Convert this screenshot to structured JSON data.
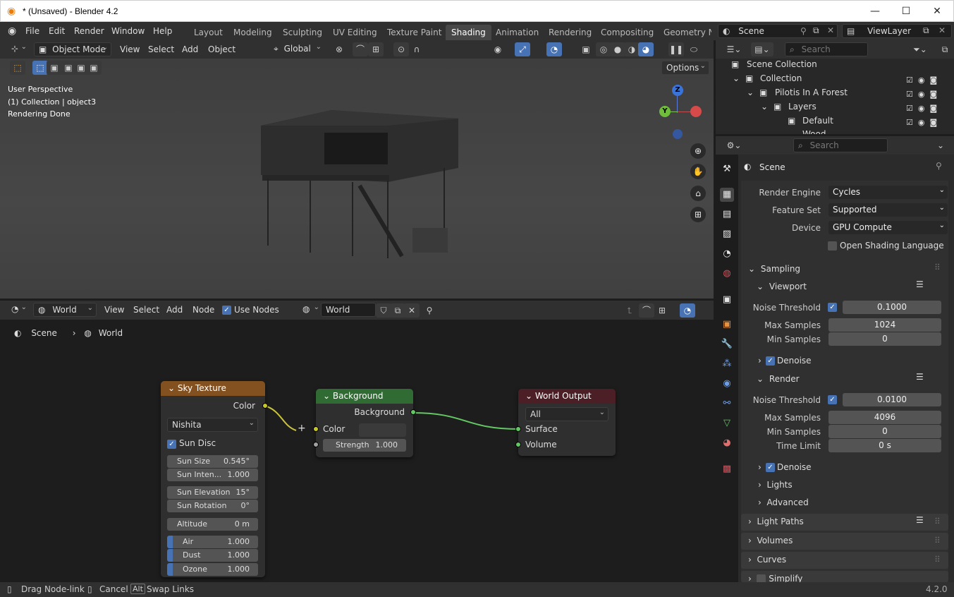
{
  "window": {
    "title": "* (Unsaved) - Blender 4.2"
  },
  "menu": [
    "File",
    "Edit",
    "Render",
    "Window",
    "Help"
  ],
  "workspaces": [
    "Layout",
    "Modeling",
    "Sculpting",
    "UV Editing",
    "Texture Paint",
    "Shading",
    "Animation",
    "Rendering",
    "Compositing",
    "Geometry Nc"
  ],
  "active_workspace": "Shading",
  "scene_name": "Scene",
  "view_layer": "ViewLayer",
  "viewport": {
    "mode": "Object Mode",
    "view": "View",
    "select": "Select",
    "add": "Add",
    "object": "Object",
    "transform": "Global",
    "options": "Options",
    "overlay_lines": [
      "User Perspective",
      "(1) Collection | object3",
      "Rendering Done"
    ],
    "gizmo": {
      "z": "Z",
      "y": "Y"
    }
  },
  "node_editor": {
    "type": "World",
    "view": "View",
    "select": "Select",
    "add": "Add",
    "node": "Node",
    "use_nodes": "Use Nodes",
    "world_name": "World",
    "breadcrumb": [
      "Scene",
      "World"
    ],
    "sky": {
      "title": "Sky Texture",
      "out": "Color",
      "sky_type": "Nishita",
      "sun_disc": "Sun Disc",
      "fields": [
        [
          "Sun Size",
          "0.545°"
        ],
        [
          "Sun Inten...",
          "1.000"
        ],
        [
          "Sun Elevation",
          "15°"
        ],
        [
          "Sun Rotation",
          "0°"
        ],
        [
          "Altitude",
          "0 m"
        ],
        [
          "Air",
          "1.000"
        ],
        [
          "Dust",
          "1.000"
        ],
        [
          "Ozone",
          "1.000"
        ]
      ]
    },
    "background": {
      "title": "Background",
      "out": "Background",
      "color": "Color",
      "strength_label": "Strength",
      "strength": "1.000"
    },
    "output": {
      "title": "World Output",
      "target": "All",
      "surface": "Surface",
      "volume": "Volume"
    }
  },
  "outliner": {
    "search": "Search",
    "items": [
      "Scene Collection",
      "Collection",
      "Pilotis In A Forest",
      "Layers",
      "Default",
      "Wood"
    ]
  },
  "properties": {
    "search": "Search",
    "context": "Scene",
    "render_engine_label": "Render Engine",
    "render_engine": "Cycles",
    "feature_set_label": "Feature Set",
    "feature_set": "Supported",
    "device_label": "Device",
    "device": "GPU Compute",
    "osl": "Open Shading Language",
    "sampling": "Sampling",
    "viewport": "Viewport",
    "render": "Render",
    "noise_threshold": "Noise Threshold",
    "max_samples": "Max Samples",
    "min_samples": "Min Samples",
    "time_limit": "Time Limit",
    "vp_noise": "0.1000",
    "vp_max": "1024",
    "vp_min": "0",
    "r_noise": "0.0100",
    "r_max": "4096",
    "r_min": "0",
    "r_time": "0 s",
    "denoise": "Denoise",
    "lights": "Lights",
    "advanced": "Advanced",
    "light_paths": "Light Paths",
    "volumes": "Volumes",
    "curves": "Curves",
    "simplify": "Simplify"
  },
  "status": {
    "drag": "Drag Node-link",
    "cancel": "Cancel",
    "alt": "Alt",
    "swap": "Swap Links",
    "version": "4.2.0"
  },
  "colors": {
    "accent": "#4772b3",
    "sky_header": "#83501f",
    "bg_header": "#2f6b33",
    "out_header": "#4b1f25",
    "link": "#63c763"
  }
}
